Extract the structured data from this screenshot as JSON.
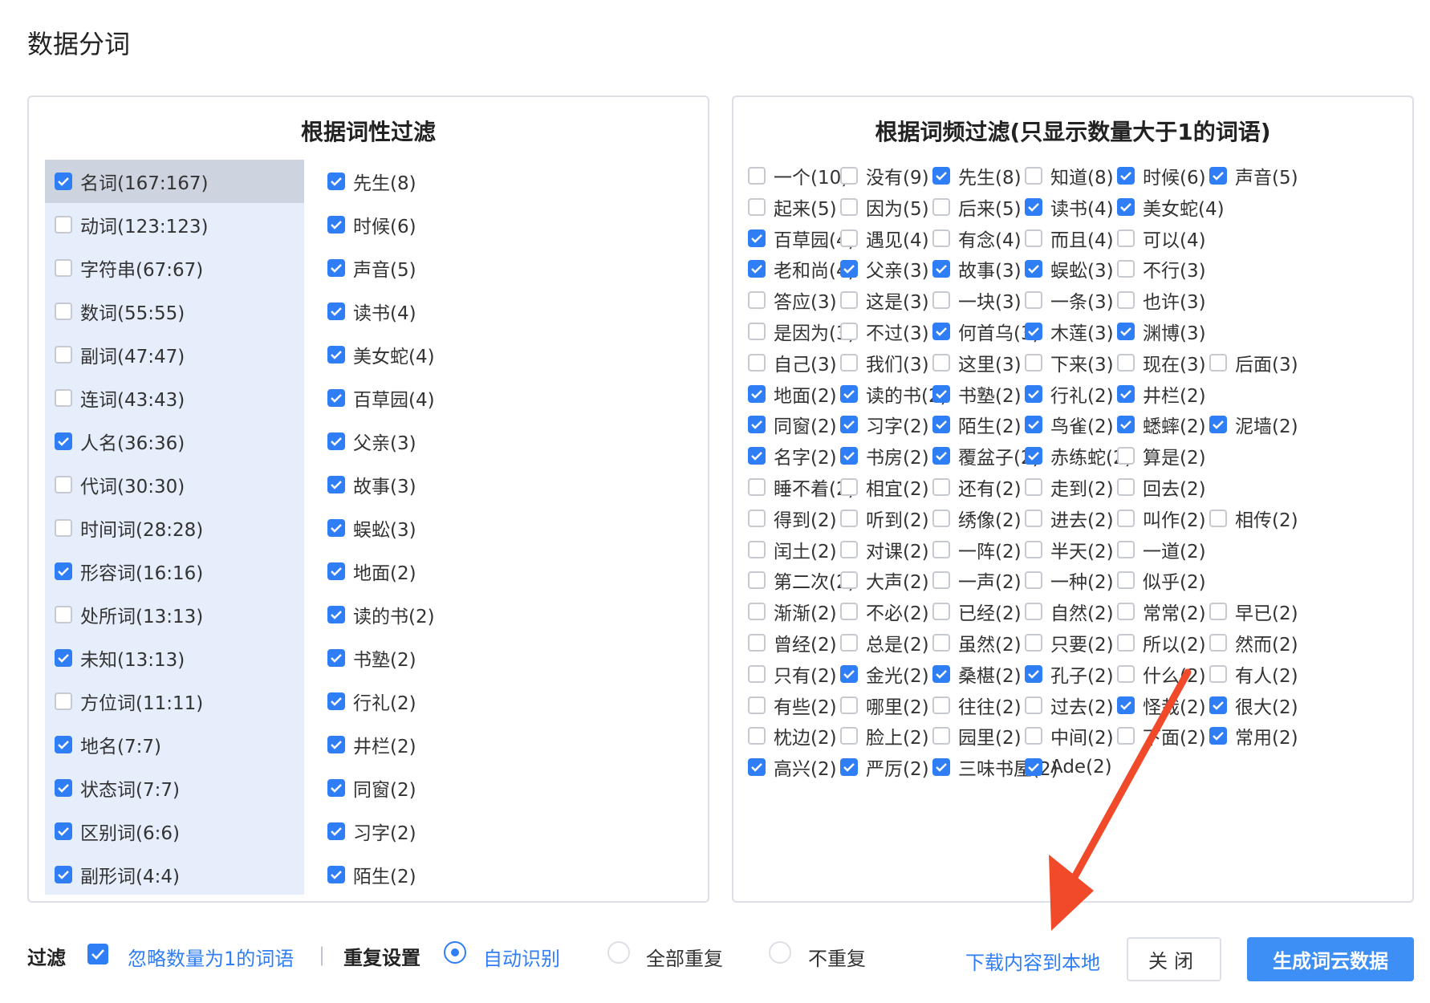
{
  "title": "数据分词",
  "left_panel": {
    "title": "根据词性过滤",
    "pos_items": [
      {
        "label": "名词(167:167)",
        "checked": true,
        "selected": true
      },
      {
        "label": "动词(123:123)",
        "checked": false
      },
      {
        "label": "字符串(67:67)",
        "checked": false
      },
      {
        "label": "数词(55:55)",
        "checked": false
      },
      {
        "label": "副词(47:47)",
        "checked": false
      },
      {
        "label": "连词(43:43)",
        "checked": false
      },
      {
        "label": "人名(36:36)",
        "checked": true
      },
      {
        "label": "代词(30:30)",
        "checked": false
      },
      {
        "label": "时间词(28:28)",
        "checked": false
      },
      {
        "label": "形容词(16:16)",
        "checked": true
      },
      {
        "label": "处所词(13:13)",
        "checked": false
      },
      {
        "label": "未知(13:13)",
        "checked": true
      },
      {
        "label": "方位词(11:11)",
        "checked": false
      },
      {
        "label": "地名(7:7)",
        "checked": true
      },
      {
        "label": "状态词(7:7)",
        "checked": true
      },
      {
        "label": "区别词(6:6)",
        "checked": true
      },
      {
        "label": "副形词(4:4)",
        "checked": true
      }
    ],
    "words": [
      {
        "label": "先生(8)",
        "checked": true
      },
      {
        "label": "时候(6)",
        "checked": true
      },
      {
        "label": "声音(5)",
        "checked": true
      },
      {
        "label": "读书(4)",
        "checked": true
      },
      {
        "label": "美女蛇(4)",
        "checked": true
      },
      {
        "label": "百草园(4)",
        "checked": true
      },
      {
        "label": "父亲(3)",
        "checked": true
      },
      {
        "label": "故事(3)",
        "checked": true
      },
      {
        "label": "蜈蚣(3)",
        "checked": true
      },
      {
        "label": "地面(2)",
        "checked": true
      },
      {
        "label": "读的书(2)",
        "checked": true
      },
      {
        "label": "书塾(2)",
        "checked": true
      },
      {
        "label": "行礼(2)",
        "checked": true
      },
      {
        "label": "井栏(2)",
        "checked": true
      },
      {
        "label": "同窗(2)",
        "checked": true
      },
      {
        "label": "习字(2)",
        "checked": true
      },
      {
        "label": "陌生(2)",
        "checked": true
      }
    ]
  },
  "right_panel": {
    "title": "根据词频过滤(只显示数量大于1的词语)",
    "rows": [
      [
        {
          "label": "一个(10)",
          "checked": false
        },
        {
          "label": "没有(9)",
          "checked": false
        },
        {
          "label": "先生(8)",
          "checked": true
        },
        {
          "label": "知道(8)",
          "checked": false
        },
        {
          "label": "时候(6)",
          "checked": true
        },
        {
          "label": "声音(5)",
          "checked": true
        }
      ],
      [
        {
          "label": "起来(5)",
          "checked": false
        },
        {
          "label": "因为(5)",
          "checked": false
        },
        {
          "label": "后来(5)",
          "checked": false
        },
        {
          "label": "读书(4)",
          "checked": true
        },
        {
          "label": "美女蛇(4)",
          "checked": true
        }
      ],
      [
        {
          "label": "百草园(4)",
          "checked": true
        },
        {
          "label": "遇见(4)",
          "checked": false
        },
        {
          "label": "有念(4)",
          "checked": false
        },
        {
          "label": "而且(4)",
          "checked": false
        },
        {
          "label": "可以(4)",
          "checked": false
        }
      ],
      [
        {
          "label": "老和尚(4)",
          "checked": true
        },
        {
          "label": "父亲(3)",
          "checked": true
        },
        {
          "label": "故事(3)",
          "checked": true
        },
        {
          "label": "蜈蚣(3)",
          "checked": true
        },
        {
          "label": "不行(3)",
          "checked": false
        }
      ],
      [
        {
          "label": "答应(3)",
          "checked": false
        },
        {
          "label": "这是(3)",
          "checked": false
        },
        {
          "label": "一块(3)",
          "checked": false
        },
        {
          "label": "一条(3)",
          "checked": false
        },
        {
          "label": "也许(3)",
          "checked": false
        }
      ],
      [
        {
          "label": "是因为(3)",
          "checked": false
        },
        {
          "label": "不过(3)",
          "checked": false
        },
        {
          "label": "何首乌(3)",
          "checked": true
        },
        {
          "label": "木莲(3)",
          "checked": true
        },
        {
          "label": "渊博(3)",
          "checked": true
        }
      ],
      [
        {
          "label": "自己(3)",
          "checked": false
        },
        {
          "label": "我们(3)",
          "checked": false
        },
        {
          "label": "这里(3)",
          "checked": false
        },
        {
          "label": "下来(3)",
          "checked": false
        },
        {
          "label": "现在(3)",
          "checked": false
        },
        {
          "label": "后面(3)",
          "checked": false
        }
      ],
      [
        {
          "label": "地面(2)",
          "checked": true
        },
        {
          "label": "读的书(2)",
          "checked": true
        },
        {
          "label": "书塾(2)",
          "checked": true
        },
        {
          "label": "行礼(2)",
          "checked": true
        },
        {
          "label": "井栏(2)",
          "checked": true
        }
      ],
      [
        {
          "label": "同窗(2)",
          "checked": true
        },
        {
          "label": "习字(2)",
          "checked": true
        },
        {
          "label": "陌生(2)",
          "checked": true
        },
        {
          "label": "鸟雀(2)",
          "checked": true
        },
        {
          "label": "蟋蟀(2)",
          "checked": true
        },
        {
          "label": "泥墙(2)",
          "checked": true
        }
      ],
      [
        {
          "label": "名字(2)",
          "checked": true
        },
        {
          "label": "书房(2)",
          "checked": true
        },
        {
          "label": "覆盆子(2)",
          "checked": true
        },
        {
          "label": "赤练蛇(2)",
          "checked": true
        },
        {
          "label": "算是(2)",
          "checked": false
        }
      ],
      [
        {
          "label": "睡不着(2)",
          "checked": false
        },
        {
          "label": "相宜(2)",
          "checked": false
        },
        {
          "label": "还有(2)",
          "checked": false
        },
        {
          "label": "走到(2)",
          "checked": false
        },
        {
          "label": "回去(2)",
          "checked": false
        }
      ],
      [
        {
          "label": "得到(2)",
          "checked": false
        },
        {
          "label": "听到(2)",
          "checked": false
        },
        {
          "label": "绣像(2)",
          "checked": false
        },
        {
          "label": "进去(2)",
          "checked": false
        },
        {
          "label": "叫作(2)",
          "checked": false
        },
        {
          "label": "相传(2)",
          "checked": false
        }
      ],
      [
        {
          "label": "闰土(2)",
          "checked": false
        },
        {
          "label": "对课(2)",
          "checked": false
        },
        {
          "label": "一阵(2)",
          "checked": false
        },
        {
          "label": "半天(2)",
          "checked": false
        },
        {
          "label": "一道(2)",
          "checked": false
        }
      ],
      [
        {
          "label": "第二次(2)",
          "checked": false
        },
        {
          "label": "大声(2)",
          "checked": false
        },
        {
          "label": "一声(2)",
          "checked": false
        },
        {
          "label": "一种(2)",
          "checked": false
        },
        {
          "label": "似乎(2)",
          "checked": false
        }
      ],
      [
        {
          "label": "渐渐(2)",
          "checked": false
        },
        {
          "label": "不必(2)",
          "checked": false
        },
        {
          "label": "已经(2)",
          "checked": false
        },
        {
          "label": "自然(2)",
          "checked": false
        },
        {
          "label": "常常(2)",
          "checked": false
        },
        {
          "label": "早已(2)",
          "checked": false
        }
      ],
      [
        {
          "label": "曾经(2)",
          "checked": false
        },
        {
          "label": "总是(2)",
          "checked": false
        },
        {
          "label": "虽然(2)",
          "checked": false
        },
        {
          "label": "只要(2)",
          "checked": false
        },
        {
          "label": "所以(2)",
          "checked": false
        },
        {
          "label": "然而(2)",
          "checked": false
        }
      ],
      [
        {
          "label": "只有(2)",
          "checked": false
        },
        {
          "label": "金光(2)",
          "checked": true
        },
        {
          "label": "桑椹(2)",
          "checked": true
        },
        {
          "label": "孔子(2)",
          "checked": true
        },
        {
          "label": "什么(2)",
          "checked": false
        },
        {
          "label": "有人(2)",
          "checked": false
        }
      ],
      [
        {
          "label": "有些(2)",
          "checked": false
        },
        {
          "label": "哪里(2)",
          "checked": false
        },
        {
          "label": "往往(2)",
          "checked": false
        },
        {
          "label": "过去(2)",
          "checked": false
        },
        {
          "label": "怪哉(2)",
          "checked": true
        },
        {
          "label": "很大(2)",
          "checked": true
        }
      ],
      [
        {
          "label": "枕边(2)",
          "checked": false
        },
        {
          "label": "脸上(2)",
          "checked": false
        },
        {
          "label": "园里(2)",
          "checked": false
        },
        {
          "label": "中间(2)",
          "checked": false
        },
        {
          "label": "下面(2)",
          "checked": false
        },
        {
          "label": "常用(2)",
          "checked": true
        }
      ],
      [
        {
          "label": "高兴(2)",
          "checked": true
        },
        {
          "label": "严厉(2)",
          "checked": true
        },
        {
          "label": "三味书屋(2)",
          "checked": true
        },
        {
          "label": "Ade(2)",
          "checked": true
        }
      ]
    ]
  },
  "bottom": {
    "filter_label": "过滤",
    "ignore_label": "忽略数量为1的词语",
    "ignore_checked": true,
    "separator": "|",
    "repeat_label": "重复设置",
    "radio_auto": "自动识别",
    "radio_all": "全部重复",
    "radio_none": "不重复",
    "selected_radio": "auto",
    "download_label": "下载内容到本地",
    "close_label": "关闭",
    "generate_label": "生成词云数据"
  },
  "colors": {
    "accent": "#2f7ef5",
    "annotation_arrow": "#f04a2a"
  }
}
